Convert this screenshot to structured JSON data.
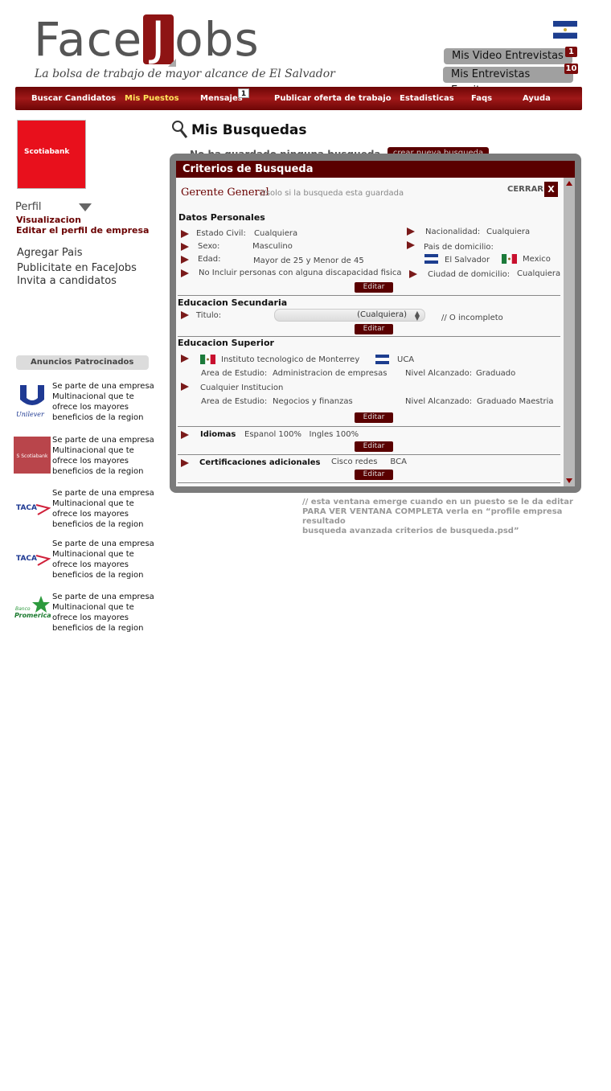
{
  "brand": {
    "logo_pre": "Face",
    "logo_j": "J",
    "logo_post": "obs",
    "tagline": "La bolsa de trabajo de mayor alcance de El Salvador"
  },
  "header_buttons": [
    {
      "label": "Mis Video Entrevistas",
      "badge": "1"
    },
    {
      "label": "Mis Entrevistas Escritas",
      "badge": "10"
    }
  ],
  "nav": {
    "items": [
      {
        "label": "Buscar Candidatos",
        "active": false
      },
      {
        "label": "Mis Puestos",
        "active": true
      },
      {
        "label": "Mensajes",
        "active": false,
        "badge": "1"
      },
      {
        "label": "Publicar oferta de trabajo",
        "active": false
      },
      {
        "label": "Estadisticas",
        "active": false
      },
      {
        "label": "Faqs",
        "active": false
      },
      {
        "label": "Ayuda",
        "active": false
      }
    ]
  },
  "sidebar": {
    "company_logo_text": "Scotiabank",
    "perfil_label": "Perfil",
    "perfil_links": [
      "Visualizacion",
      "Editar el perfil de empresa"
    ],
    "links": [
      "Agregar Pais",
      "Publicitate en FaceJobs",
      "Invita a candidatos"
    ],
    "ads_title": "Anuncios Patrocinados",
    "ads": [
      {
        "brand": "Unilever",
        "text": "Se parte de una empresa Multinacional que te ofrece los mayores beneficios de la region"
      },
      {
        "brand": "Scotiabank",
        "text": "Se parte de una empresa Multinacional que te ofrece los mayores beneficios de la region"
      },
      {
        "brand": "TACA",
        "text": "Se parte de una empresa Multinacional que te ofrece los mayores beneficios de la region"
      },
      {
        "brand": "TACA",
        "text": "Se parte de una empresa Multinacional que te ofrece los mayores beneficios de la region"
      },
      {
        "brand": "Banco Promerica",
        "text": "Se parte de una empresa Multinacional que te ofrece los mayores beneficios de la region"
      }
    ]
  },
  "main": {
    "title": "Mis Busquedas",
    "empty_text": "No ha guardado ninguna busqueda",
    "new_search_button": "crear nueva busqueda"
  },
  "panel": {
    "title": "Criterios de Busqueda",
    "search_name": "Gerente General",
    "search_name_note": "//solo si la busqueda esta guardada",
    "close_label": "CERRAR",
    "close_x": "X",
    "edit_label": "Editar",
    "datos": {
      "heading": "Datos Personales",
      "estado_civil_label": "Estado Civil:",
      "estado_civil_value": "Cualquiera",
      "sexo_label": "Sexo:",
      "sexo_value": "Masculino",
      "edad_label": "Edad:",
      "edad_value": "Mayor de 25 y Menor de 45",
      "discapacidad": "No Incluir personas con alguna discapacidad fisica",
      "nacionalidad_label": "Nacionalidad:",
      "nacionalidad_value": "Cualquiera",
      "pais_label": "Pais de domicilio:",
      "pais_1": "El Salvador",
      "pais_2": "Mexico",
      "ciudad_label": "Ciudad de domicilio:",
      "ciudad_value": "Cualquiera"
    },
    "secundaria": {
      "heading": "Educacion Secundaria",
      "titulo_label": "Titulo:",
      "titulo_value": "(Cualquiera)",
      "note": "// O incompleto"
    },
    "superior": {
      "heading": "Educacion Superior",
      "inst_1": "Instituto tecnologico de Monterrey",
      "inst_2": "UCA",
      "area_label": "Area de Estudio:",
      "area_1": "Administracion de empresas",
      "nivel_label": "Nivel Alcanzado:",
      "nivel_1": "Graduado",
      "inst_3": "Cualquier Institucion",
      "area_2": "Negocios y finanzas",
      "nivel_2": "Graduado Maestria"
    },
    "idiomas": {
      "label": "Idiomas",
      "value": "Espanol 100%   Ingles 100%"
    },
    "cert": {
      "label": "Certificaciones adicionales",
      "value": "Cisco redes     BCA"
    }
  },
  "note_lines": [
    "// esta ventana emerge cuando en un puesto se le da editar",
    "PARA VER VENTANA COMPLETA verla en “profile empresa resultado",
    "busqueda avanzada criterios de busqueda.psd”"
  ],
  "colors": {
    "brand_red": "#7a0b0b",
    "nav_active": "#ffe45a"
  }
}
